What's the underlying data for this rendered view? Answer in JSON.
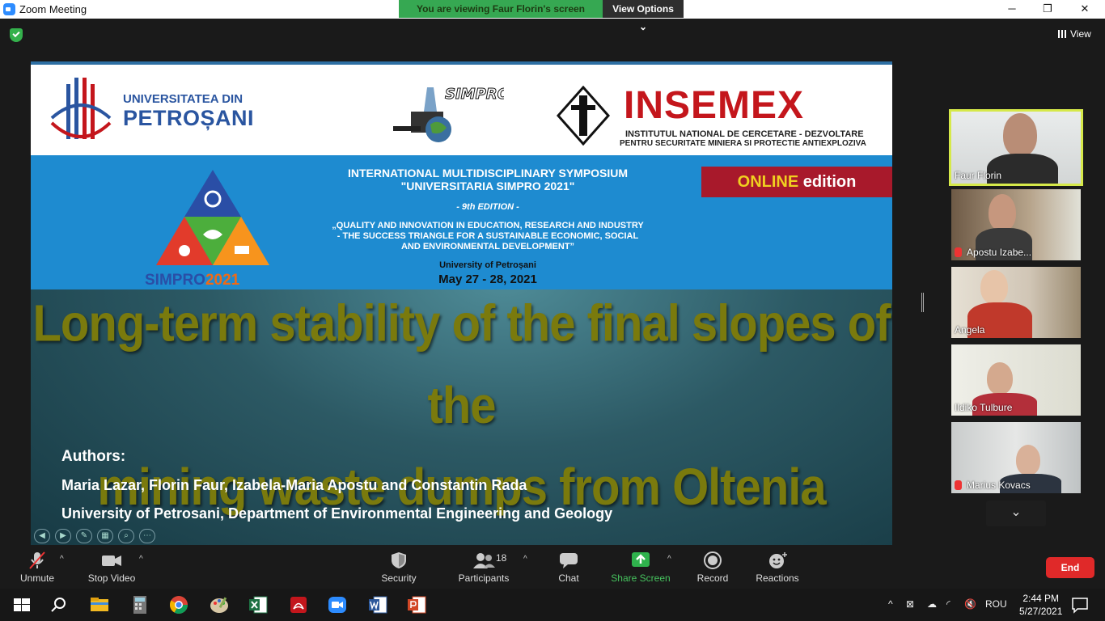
{
  "window": {
    "title": "Zoom Meeting",
    "min": "─",
    "restore": "❐",
    "close": "✕"
  },
  "share_banner": {
    "viewing": "You are viewing Faur Florin's screen",
    "view_options": "View Options ⌄"
  },
  "top_right": {
    "view_label": "View"
  },
  "slide": {
    "university_line1": "UNIVERSITATEA DIN",
    "university_line2": "PETROȘANI",
    "simpro_logo_text": "SIMPRO",
    "insemex_title": "INSEMEX",
    "insemex_sub1": "INSTITUTUL NATIONAL DE CERCETARE - DEZVOLTARE",
    "insemex_sub2": "PENTRU SECURITATE MINIERA SI PROTECTIE ANTIEXPLOZIVA",
    "symposium_line1": "INTERNATIONAL MULTIDISCIPLINARY SYMPOSIUM",
    "symposium_line2": "\"UNIVERSITARIA SIMPRO 2021\"",
    "edition": "- 9th EDITION -",
    "theme_line1": "„QUALITY AND INNOVATION IN EDUCATION, RESEARCH AND INDUSTRY",
    "theme_line2": "- THE SUCCESS TRIANGLE FOR A SUSTAINABLE ECONOMIC, SOCIAL",
    "theme_line3": "AND ENVIRONMENTAL DEVELOPMENT”",
    "venue": "University of Petroșani",
    "dates": "May 27 - 28, 2021",
    "online_highlight": "ONLINE",
    "online_rest": " edition",
    "simpro_brand": "SIMPRO",
    "simpro_year": "2021",
    "title_line1": "Long-term stability of the final slopes of the",
    "title_line2": "mining waste dumps from Oltenia",
    "authors_heading": "Authors:",
    "authors": "Maria Lazar, Florin Faur, Izabela-Maria Apostu and Constantin Rada",
    "affiliation": "University of Petrosani, Department of Environmental Engineering and Geology"
  },
  "participants_panel": [
    {
      "name": "Faur Florin",
      "muted": false,
      "active": true
    },
    {
      "name": "Apostu Izabe...",
      "muted": true,
      "active": false
    },
    {
      "name": "Angela",
      "muted": false,
      "active": false
    },
    {
      "name": "Ildiko Tulbure",
      "muted": false,
      "active": false
    },
    {
      "name": "Marius Kovacs",
      "muted": true,
      "active": false
    }
  ],
  "more_down": "⌄",
  "toolbar": {
    "unmute": "Unmute",
    "stop_video": "Stop Video",
    "security": "Security",
    "participants": "Participants",
    "participants_count": "18",
    "chat": "Chat",
    "share_screen": "Share Screen",
    "record": "Record",
    "reactions": "Reactions",
    "end": "End"
  },
  "taskbar": {
    "language": "ROU",
    "time": "2:44 PM",
    "date": "5/27/2021"
  },
  "colors": {
    "zoom_blue": "#2D8CFF",
    "share_green": "#36a852",
    "end_red": "#e02929",
    "title_olive": "#7a7a0d"
  }
}
